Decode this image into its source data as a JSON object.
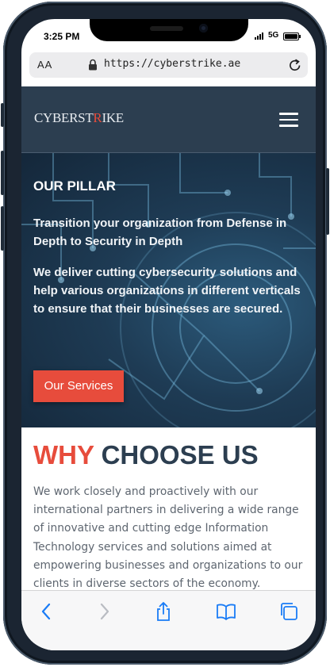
{
  "status_bar": {
    "time": "3:25 PM",
    "network": "5G"
  },
  "browser": {
    "text_size_label": "AA",
    "url": "https://cyberstrike.ae",
    "icons": {
      "lock": "lock-icon",
      "reload": "reload-icon"
    }
  },
  "site_header": {
    "logo_prefix": "CYBERST",
    "logo_accent": "R",
    "logo_suffix": "IKE",
    "menu_icon": "hamburger-menu-icon",
    "background": "#2c3e50"
  },
  "hero": {
    "title": "OUR PILLAR",
    "tagline": "Transition your organization from Defense in Depth to Security in Depth",
    "description": "We deliver cutting cybersecurity solutions and help various organizations in different verticals to ensure that their businesses are secured.",
    "cta_label": "Our Services"
  },
  "why_choose": {
    "heading_accent": "WHY",
    "heading_rest": "CHOOSE US",
    "body": "We work closely and proactively with our international partners in delivering a wide range of innovative and cutting edge Information Technology services and solutions aimed at empowering businesses and organizations to our clients in diverse sectors of the economy."
  },
  "toolbar": {
    "icons": [
      "back-icon",
      "forward-icon",
      "share-icon",
      "bookmarks-icon",
      "tabs-icon"
    ]
  },
  "colors": {
    "accent": "#e74c3c",
    "navy": "#2c3e50",
    "safari_blue": "#1a7cf6",
    "body_text": "#5e6670"
  }
}
